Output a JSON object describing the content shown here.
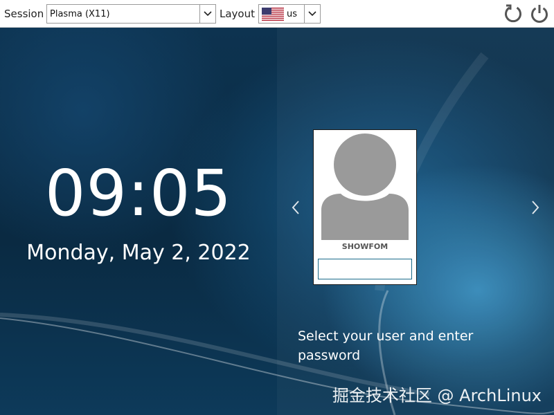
{
  "topbar": {
    "session_label": "Session",
    "session_value": "Plasma (X11)",
    "layout_label": "Layout",
    "layout_value": "us",
    "layout_flag": "us-flag-icon"
  },
  "clock": {
    "time": "09:05",
    "date": "Monday, May 2, 2022"
  },
  "user": {
    "name": "SHOWFOM",
    "password_placeholder": ""
  },
  "prompt": {
    "text": "Select your user and enter password"
  },
  "watermark": "掘金技术社区 @ ArchLinux",
  "icons": {
    "reboot": "reboot-icon",
    "shutdown": "power-icon",
    "prev": "chevron-left-icon",
    "next": "chevron-right-icon",
    "avatar": "default-avatar-icon",
    "dropdown": "chevron-down-icon"
  },
  "colors": {
    "topbar_bg": "#ffffff",
    "background": "#0b2b43",
    "accent": "#1a6a8a",
    "avatar_gray": "#9a9a9a"
  }
}
